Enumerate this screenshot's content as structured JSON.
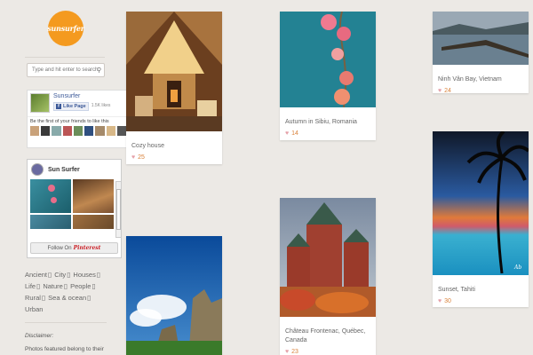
{
  "logo": {
    "text": "sunsurfer"
  },
  "search": {
    "placeholder": "Type and hit enter to search"
  },
  "facebook": {
    "page_name": "Sunsurfer",
    "like_label": "Like Page",
    "count": "1.5K likes",
    "friends_text": "Be the first of your friends to like this"
  },
  "pinterest": {
    "title": "Sun Surfer",
    "follow_label": "Follow On",
    "brand": "Pinterest"
  },
  "tags": [
    {
      "label": "Ancient"
    },
    {
      "label": "City"
    },
    {
      "label": "Houses"
    },
    {
      "label": "Life"
    },
    {
      "label": "Nature"
    },
    {
      "label": "People"
    },
    {
      "label": "Rural"
    },
    {
      "label": "Sea & ocean"
    },
    {
      "label": "Urban"
    }
  ],
  "disclaimer": {
    "heading": "Disclaimer:",
    "body": "Photos featured belong to their respective owners. If your"
  },
  "posts": [
    {
      "caption": "Cozy house",
      "likes": "25"
    },
    {
      "caption": "Autumn in Sibiu, Romania",
      "likes": "14"
    },
    {
      "caption": "Ninh Vân Bay, Vietnam",
      "likes": "24"
    },
    {
      "caption": "Sunset, Tahiti",
      "likes": "30"
    },
    {
      "caption": "Château Frontenac, Québec, Canada",
      "likes": "23"
    }
  ],
  "colors": {
    "accent": "#f49a1f",
    "background": "#ece9e5",
    "heart": "#e5a0a8"
  }
}
